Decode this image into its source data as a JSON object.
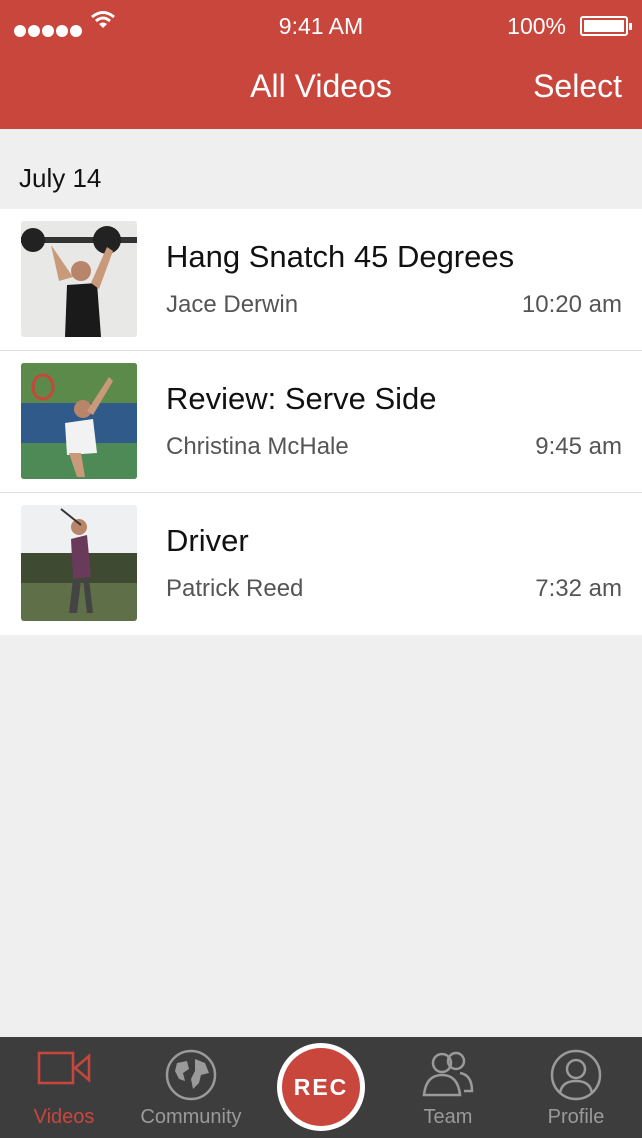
{
  "status": {
    "time": "9:41 AM",
    "battery": "100%"
  },
  "nav": {
    "title": "All Videos",
    "select_label": "Select"
  },
  "section": {
    "date": "July 14"
  },
  "videos": [
    {
      "title": "Hang Snatch 45 Degrees",
      "person": "Jace Derwin",
      "time": "10:20 am"
    },
    {
      "title": "Review: Serve Side",
      "person": "Christina McHale",
      "time": "9:45 am"
    },
    {
      "title": "Driver",
      "person": "Patrick Reed",
      "time": "7:32 am"
    }
  ],
  "tabs": {
    "videos": "Videos",
    "community": "Community",
    "rec": "REC",
    "team": "Team",
    "profile": "Profile"
  },
  "colors": {
    "accent": "#c9463d",
    "tabbar": "#3d3d3d",
    "background": "#efefef"
  }
}
